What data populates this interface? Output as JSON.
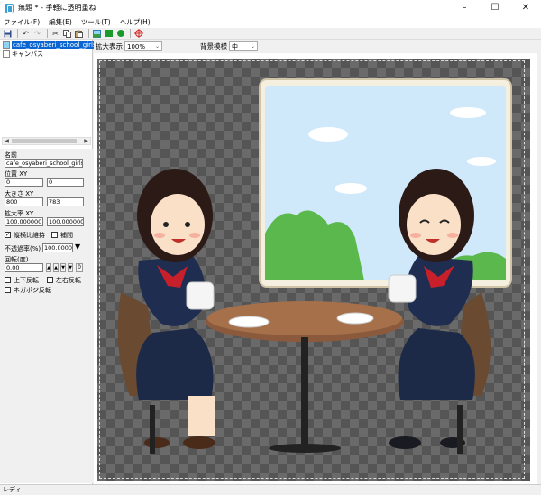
{
  "window": {
    "title": "無題 * - 手軽に透明重ね",
    "minimize": "–",
    "maximize": "☐",
    "close": "✕"
  },
  "menu": [
    "ファイル(F)",
    "編集(E)",
    "ツール(T)",
    "ヘルプ(H)"
  ],
  "toolbar": {
    "icons": [
      "save-icon",
      "undo-icon",
      "redo-icon",
      "cut-icon",
      "copy-icon",
      "paste-icon",
      "image-icon",
      "green-square-icon",
      "green-circle-icon",
      "crosshair-icon"
    ],
    "colors": {
      "accent_green": "#1a9a2a",
      "crosshair_red": "#d42020",
      "selection": "#0a64d2"
    }
  },
  "layers": {
    "items": [
      {
        "label": "cafe_osyaberi_school_girls.pn",
        "selected": true
      },
      {
        "label": "キャンバス",
        "selected": false
      }
    ]
  },
  "properties": {
    "name_label": "名前",
    "name_value": "cafe_osyaberi_school_girls.p",
    "position_label": "位置 XY",
    "pos_x": "0",
    "pos_y": "0",
    "size_label": "大きさ XY",
    "size_x": "800",
    "size_y": "783",
    "scale_label": "拡大率 XY",
    "scale_x": "100.000000",
    "scale_y": "100.000000",
    "keep_ratio_label": "縦横比維持",
    "keep_ratio_checked": true,
    "interpolate_label": "補間",
    "interpolate_checked": false,
    "opacity_label": "不透過率(%)",
    "opacity_value": "100.00000",
    "rotation_label": "回転(度)",
    "rotation_value": "0.00",
    "rotation_reset": "0",
    "flip_h_label": "上下反転",
    "flip_v_label": "左右反転",
    "negative_label": "ネガポジ反転"
  },
  "view": {
    "zoom_label": "拡大表示",
    "zoom_value": "100%",
    "bg_label": "背景模様",
    "bg_value": "中"
  },
  "status": {
    "text": "レディ"
  }
}
